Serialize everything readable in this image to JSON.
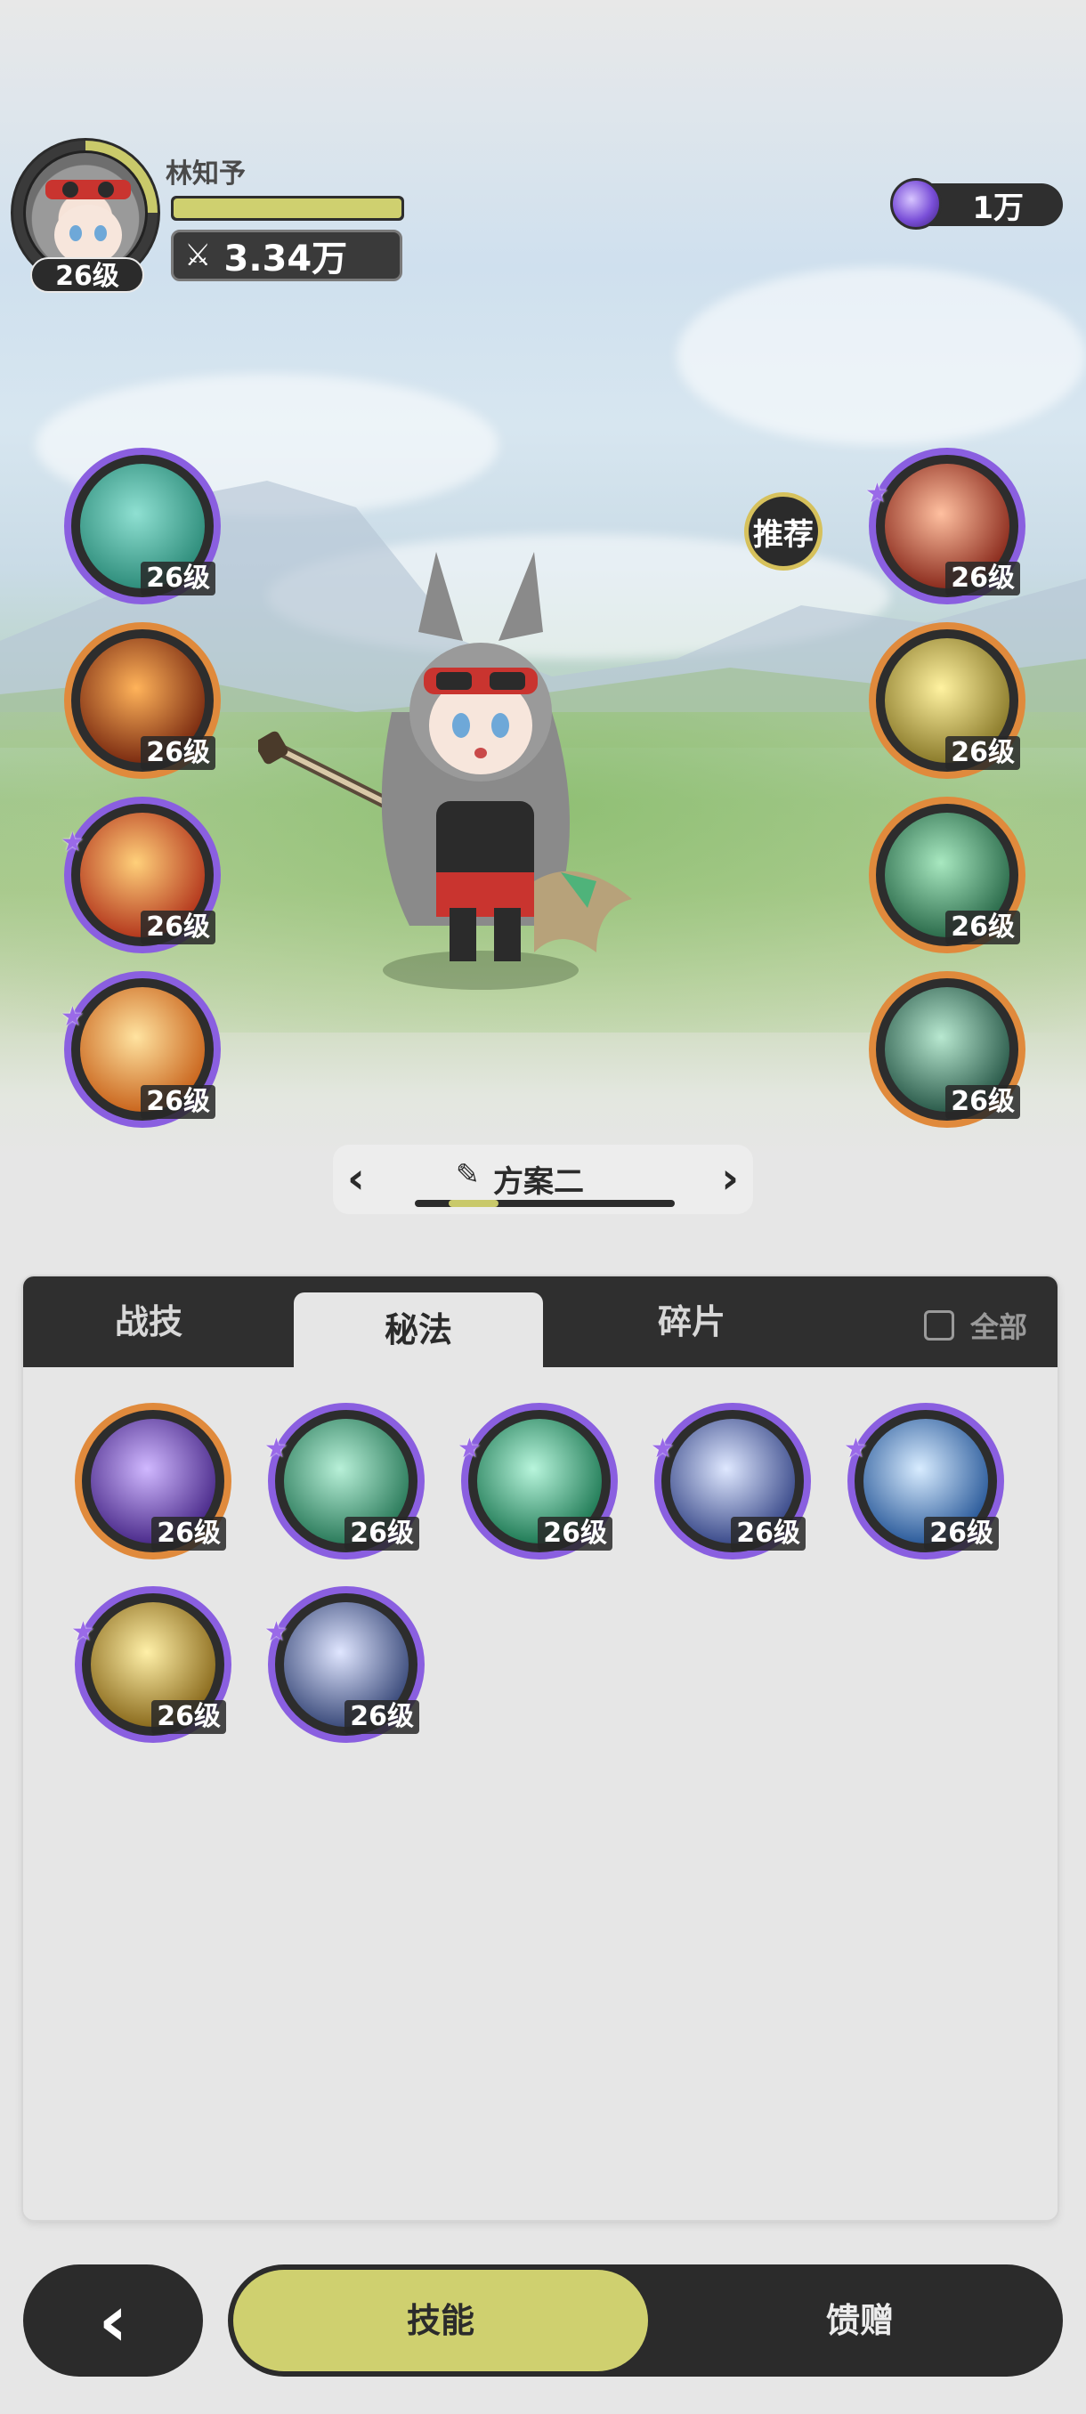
{
  "player": {
    "name": "林知予",
    "level": "26级",
    "power": "3.34万",
    "hp_fraction": 1.0
  },
  "currency": {
    "icon": "crystal-icon",
    "amount": "1万"
  },
  "left_skills": [
    {
      "name": "swirl-skill-icon",
      "level": "26级",
      "rim": "purple",
      "starred": false
    },
    {
      "name": "fire-wave-skill-icon",
      "level": "26级",
      "rim": "orange",
      "starred": false
    },
    {
      "name": "flame-skill-icon",
      "level": "26级",
      "rim": "purple",
      "starred": true
    },
    {
      "name": "fire-burst-skill-icon",
      "level": "26级",
      "rim": "purple",
      "starred": true
    }
  ],
  "right_skills": [
    {
      "name": "fire-heart-skill-icon",
      "level": "26级",
      "rim": "purple",
      "starred": true
    },
    {
      "name": "light-arrow-skill-icon",
      "level": "26级",
      "rim": "orange",
      "starred": false
    },
    {
      "name": "green-heart-skill-icon",
      "level": "26级",
      "rim": "orange",
      "starred": false
    },
    {
      "name": "green-shield-skill-icon",
      "level": "26级",
      "rim": "orange",
      "starred": false
    }
  ],
  "recommend_label": "推荐",
  "plan": {
    "title": "方案二"
  },
  "tabs": {
    "combat": "战技",
    "secret": "秘法",
    "fragments": "碎片",
    "all": "全部"
  },
  "secret_skills": [
    {
      "name": "purple-rune-skill-icon",
      "level": "26级",
      "rim": "orange",
      "starred": false
    },
    {
      "name": "green-leaf-skill-icon",
      "level": "26级",
      "rim": "purple",
      "starred": true
    },
    {
      "name": "green-orb-skill-icon",
      "level": "26级",
      "rim": "purple",
      "starred": true
    },
    {
      "name": "blue-star-skill-icon",
      "level": "26级",
      "rim": "purple",
      "starred": true
    },
    {
      "name": "ice-figure-skill-icon",
      "level": "26级",
      "rim": "purple",
      "starred": true
    },
    {
      "name": "golden-hand-skill-icon",
      "level": "26级",
      "rim": "purple",
      "starred": true
    },
    {
      "name": "crystal-shield-skill-icon",
      "level": "26级",
      "rim": "purple",
      "starred": true
    }
  ],
  "bottom": {
    "skills": "技能",
    "gifts": "馈赠",
    "back_icon": "back-arrow-icon"
  },
  "colors": {
    "accent": "#cfd06f",
    "purple_rim": "#8a5fe0",
    "orange_rim": "#e08a3c",
    "dark": "#2b2b2b"
  }
}
